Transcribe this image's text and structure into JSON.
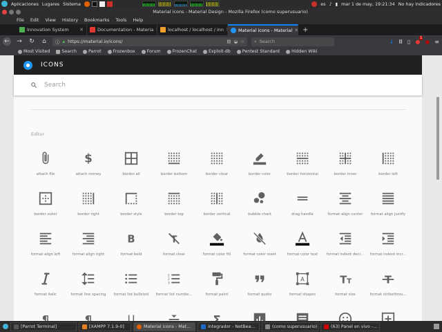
{
  "os_panel": {
    "menus": [
      "Aplicaciones",
      "Lugares",
      "Sistema"
    ],
    "lang": "es",
    "clock": "mar 1 de may, 19:21:34",
    "network": "No hay indicadores"
  },
  "window": {
    "title": "Material icons - Material Design - Mozilla Firefox (como superusuario)"
  },
  "menubar": [
    "File",
    "Edit",
    "View",
    "History",
    "Bookmarks",
    "Tools",
    "Help"
  ],
  "tabs": [
    {
      "label": "Innovation System",
      "color": "#4caf50"
    },
    {
      "label": "Documentation - Materia",
      "color": "#e53935"
    },
    {
      "label": "localhost / localhost / inn",
      "color": "#f0a030"
    },
    {
      "label": "Material icons - Material",
      "color": "#2196f3",
      "active": true
    }
  ],
  "navbar": {
    "url": "https://material.io/icons/",
    "search_placeholder": "Search",
    "badge": "1"
  },
  "bookmarks": [
    "Most Visited",
    "Search",
    "Parrot",
    "Frozenbox",
    "Forum",
    "FrozenChat",
    "Exploit-db",
    "Pentest Standard",
    "Hidden Wiki"
  ],
  "page": {
    "title": "ICONS",
    "search_placeholder": "Search",
    "section": "Editor",
    "icons": [
      {
        "name": "attach file",
        "icon": "attach"
      },
      {
        "name": "attach money",
        "icon": "money"
      },
      {
        "name": "border all",
        "icon": "border-all"
      },
      {
        "name": "border bottom",
        "icon": "border-bottom"
      },
      {
        "name": "border clear",
        "icon": "border-clear"
      },
      {
        "name": "border color",
        "icon": "border-color"
      },
      {
        "name": "border horizontal",
        "icon": "border-horizontal"
      },
      {
        "name": "border inner",
        "icon": "border-inner"
      },
      {
        "name": "border left",
        "icon": "border-left"
      },
      {
        "name": "border outer",
        "icon": "border-outer"
      },
      {
        "name": "border right",
        "icon": "border-right"
      },
      {
        "name": "border style",
        "icon": "border-style"
      },
      {
        "name": "border top",
        "icon": "border-top"
      },
      {
        "name": "border vertical",
        "icon": "border-vertical"
      },
      {
        "name": "bubble chart",
        "icon": "bubble"
      },
      {
        "name": "drag handle",
        "icon": "drag"
      },
      {
        "name": "format align center",
        "icon": "align-center"
      },
      {
        "name": "format align justify",
        "icon": "align-justify"
      },
      {
        "name": "format align left",
        "icon": "align-left"
      },
      {
        "name": "format align right",
        "icon": "align-right"
      },
      {
        "name": "format bold",
        "icon": "bold"
      },
      {
        "name": "format clear",
        "icon": "clear"
      },
      {
        "name": "format color fill",
        "icon": "fill"
      },
      {
        "name": "format color reset",
        "icon": "reset"
      },
      {
        "name": "format color text",
        "icon": "text"
      },
      {
        "name": "format indent decr...",
        "icon": "indent-decrease"
      },
      {
        "name": "format indent incr...",
        "icon": "indent-increase"
      },
      {
        "name": "format italic",
        "icon": "italic"
      },
      {
        "name": "format line spacing",
        "icon": "line-spacing"
      },
      {
        "name": "format list bulleted",
        "icon": "list-bulleted"
      },
      {
        "name": "format list numbe...",
        "icon": "list-numbered"
      },
      {
        "name": "format paint",
        "icon": "paint"
      },
      {
        "name": "format quote",
        "icon": "quote"
      },
      {
        "name": "format shapes",
        "icon": "shapes"
      },
      {
        "name": "format size",
        "icon": "size"
      },
      {
        "name": "format strikethrou...",
        "icon": "strike"
      },
      {
        "name": "",
        "icon": "paragraph"
      },
      {
        "name": "",
        "icon": "textdirection"
      },
      {
        "name": "",
        "icon": "underline"
      },
      {
        "name": "",
        "icon": "vertical-align"
      },
      {
        "name": "",
        "icon": "function"
      },
      {
        "name": "",
        "icon": "chart"
      },
      {
        "name": "",
        "icon": "comment"
      },
      {
        "name": "",
        "icon": "emoticon"
      },
      {
        "name": "",
        "icon": "insert"
      }
    ]
  },
  "taskbar": [
    {
      "label": "[Parrot Terminal]",
      "color": "#555"
    },
    {
      "label": "[XAMPP 7.1.9-0]",
      "color": "#e67e22"
    },
    {
      "label": "Material icons - Mat...",
      "color": "#e66000",
      "active": true
    },
    {
      "label": "integrador - NetBea...",
      "color": "#1b6ac9"
    },
    {
      "label": "(como superusuario)",
      "color": "#888"
    },
    {
      "label": "(63) Panel en vivo -...",
      "color": "#c00"
    }
  ]
}
